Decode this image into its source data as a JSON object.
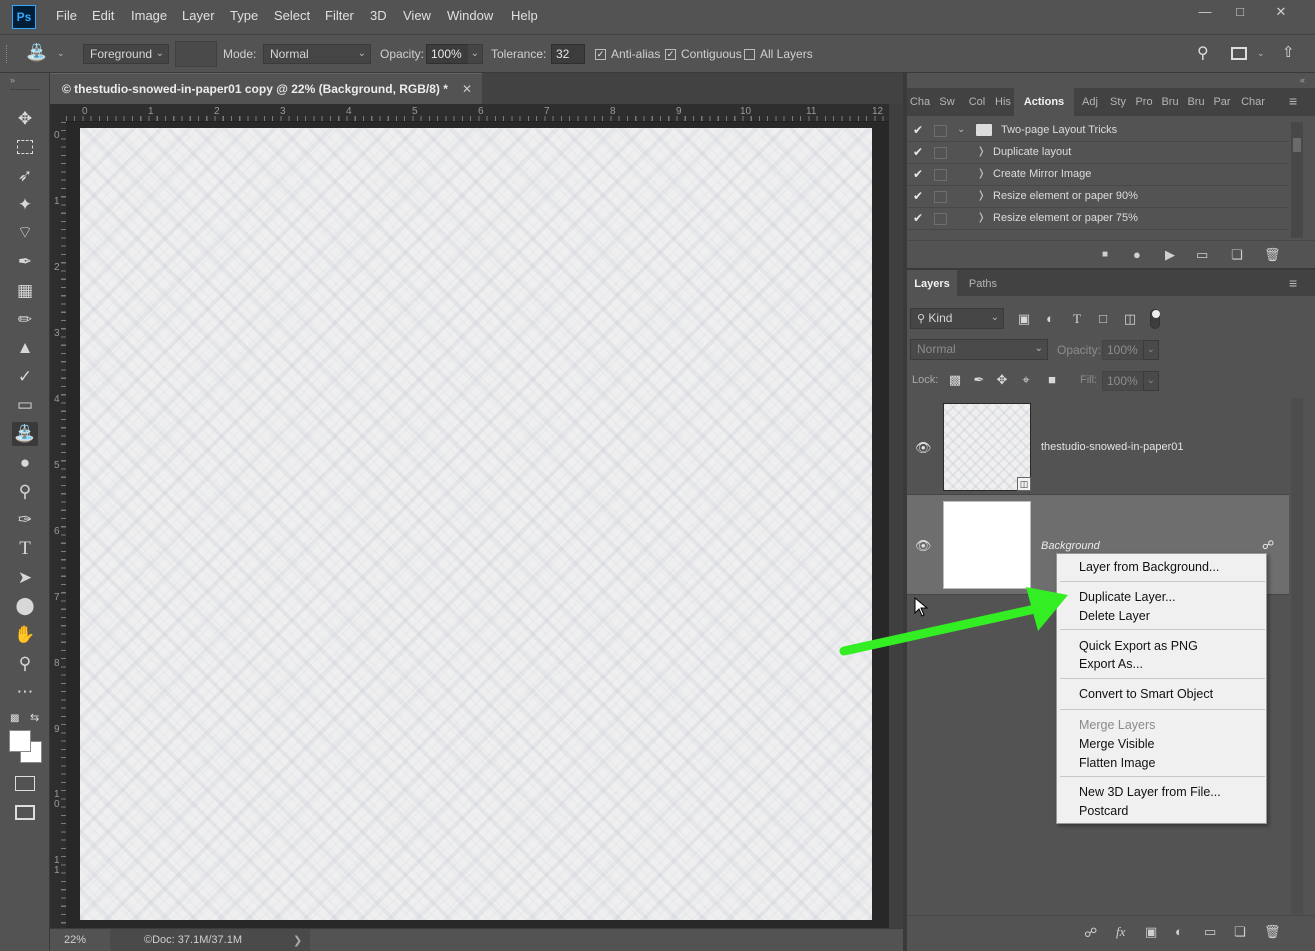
{
  "app": {
    "logo_text": "Ps",
    "menu": [
      "File",
      "Edit",
      "Image",
      "Layer",
      "Type",
      "Select",
      "Filter",
      "3D",
      "View",
      "Window",
      "Help"
    ],
    "window_controls": [
      "minimize",
      "restore",
      "close"
    ]
  },
  "options": {
    "fill_source": "Foreground",
    "mode_label": "Mode:",
    "mode_value": "Normal",
    "opacity_label": "Opacity:",
    "opacity_value": "100%",
    "tolerance_label": "Tolerance:",
    "tolerance_value": "32",
    "anti_alias_label": "Anti-alias",
    "anti_alias_checked": true,
    "contiguous_label": "Contiguous",
    "contiguous_checked": true,
    "all_layers_label": "All Layers",
    "all_layers_checked": false
  },
  "toolbar": {
    "tools": [
      "move-icon",
      "marquee-icon",
      "lasso-icon",
      "magic-wand-icon",
      "crop-icon",
      "eyedropper-icon",
      "healing-icon",
      "brush-icon",
      "stamp-icon",
      "history-brush-icon",
      "eraser-icon",
      "paint-bucket-icon",
      "blur-icon",
      "dodge-icon",
      "pen-icon",
      "type-icon",
      "path-select-icon",
      "ellipse-icon",
      "hand-icon",
      "zoom-icon",
      "more-icon"
    ],
    "active_tool": "paint-bucket-icon"
  },
  "document": {
    "tab_title": "© thestudio-snowed-in-paper01 copy @ 22% (Background, RGB/8) *",
    "ruler_top": [
      "0",
      "1",
      "2",
      "3",
      "4",
      "5",
      "6",
      "7",
      "8",
      "9",
      "10",
      "11",
      "12"
    ],
    "ruler_left": [
      "0",
      "1",
      "2",
      "3",
      "4",
      "5",
      "6",
      "7",
      "8",
      "9",
      "1\n0",
      "1\n1"
    ]
  },
  "status": {
    "zoom": "22%",
    "doc_info": "©Doc: 37.1M/37.1M",
    "arrow": "❯"
  },
  "actions_panel": {
    "tabs": [
      "Cha",
      "Sw",
      "Col",
      "His",
      "Actions",
      "Adj",
      "Sty",
      "Pro",
      "Bru",
      "Bru",
      "Par",
      "Char"
    ],
    "active_tab": "Actions",
    "set_name": "Two-page Layout Tricks",
    "items": [
      "Duplicate layout",
      "Create Mirror Image",
      "Resize element or paper 90%",
      "Resize element or paper 75%"
    ]
  },
  "layers_panel": {
    "tabs": [
      "Layers",
      "Paths"
    ],
    "active_tab": "Layers",
    "filter_kind": "Kind",
    "blend_mode": "Normal",
    "opacity_label": "Opacity:",
    "opacity_value": "100%",
    "lock_label": "Lock:",
    "fill_label": "Fill:",
    "fill_value": "100%",
    "layers": [
      {
        "name": "thestudio-snowed-in-paper01",
        "visible": true,
        "selected": false
      },
      {
        "name": "Background",
        "visible": true,
        "selected": true,
        "locked": true
      }
    ]
  },
  "context_menu": {
    "groups": [
      [
        {
          "label": "Layer from Background...",
          "enabled": true
        }
      ],
      [
        {
          "label": "Duplicate Layer...",
          "enabled": true,
          "highlighted": true
        },
        {
          "label": "Delete Layer",
          "enabled": true
        }
      ],
      [
        {
          "label": "Quick Export as PNG",
          "enabled": true
        },
        {
          "label": "Export As...",
          "enabled": true
        }
      ],
      [
        {
          "label": "Convert to Smart Object",
          "enabled": true
        }
      ],
      [
        {
          "label": "Merge Layers",
          "enabled": false
        },
        {
          "label": "Merge Visible",
          "enabled": true
        },
        {
          "label": "Flatten Image",
          "enabled": true
        }
      ],
      [
        {
          "label": "New 3D Layer from File...",
          "enabled": true
        },
        {
          "label": "Postcard",
          "enabled": true
        }
      ]
    ]
  },
  "annotation": {
    "arrow_color": "#33ee22"
  }
}
